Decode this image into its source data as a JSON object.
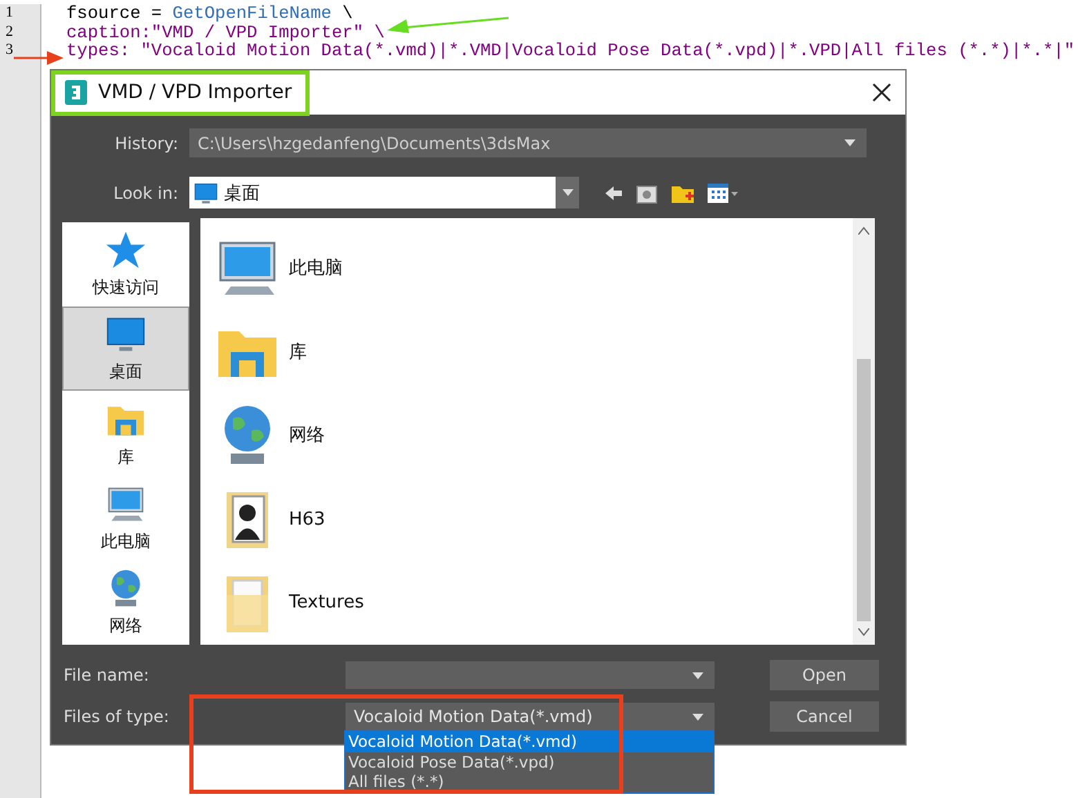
{
  "editor": {
    "lines": [
      {
        "number": "1",
        "segments": [
          {
            "kind": "plain",
            "text": "fsource = "
          },
          {
            "kind": "function",
            "text": "GetOpenFileName"
          },
          {
            "kind": "plain",
            "text": " \\"
          }
        ]
      },
      {
        "number": "2",
        "segments": [
          {
            "kind": "string",
            "text": "caption:\"VMD / VPD Importer\" \\"
          }
        ]
      },
      {
        "number": "3",
        "segments": [
          {
            "kind": "string",
            "text": "types: \"Vocaloid Motion Data(*.vmd)|*.VMD|Vocaloid Pose Data(*.vpd)|*.VPD|All files (*.*)|*.*|\""
          }
        ]
      }
    ]
  },
  "dialog": {
    "title": "VMD / VPD Importer",
    "history": {
      "label": "History:",
      "value": "C:\\Users\\hzgedanfeng\\Documents\\3dsMax"
    },
    "look_in": {
      "label": "Look in:",
      "value": "桌面"
    },
    "places": [
      {
        "label": "快速访问",
        "kind": "star",
        "selected": false
      },
      {
        "label": "桌面",
        "kind": "desktop",
        "selected": true
      },
      {
        "label": "库",
        "kind": "library",
        "selected": false
      },
      {
        "label": "此电脑",
        "kind": "computer",
        "selected": false
      },
      {
        "label": "网络",
        "kind": "network",
        "selected": false
      }
    ],
    "files": [
      {
        "name": "此电脑",
        "kind": "computer"
      },
      {
        "name": "库",
        "kind": "library"
      },
      {
        "name": "网络",
        "kind": "network"
      },
      {
        "name": "H63",
        "kind": "user"
      },
      {
        "name": "Textures",
        "kind": "folder"
      }
    ],
    "file_name": {
      "label": "File name:"
    },
    "files_of_type": {
      "label": "Files of type:",
      "value": "Vocaloid Motion Data(*.vmd)",
      "expanded": true,
      "options": [
        {
          "label": "Vocaloid Motion Data(*.vmd)",
          "selected": true
        },
        {
          "label": "Vocaloid Pose Data(*.vpd)",
          "selected": false
        },
        {
          "label": "All files (*.*)",
          "selected": false
        }
      ]
    },
    "buttons": [
      "Open",
      "Cancel"
    ]
  },
  "annotations": [
    {
      "kind": "arrow",
      "color": "#66dd22"
    },
    {
      "kind": "arrow",
      "color": "#e8401c"
    },
    {
      "kind": "box",
      "color": "#7ed321"
    },
    {
      "kind": "box",
      "color": "#e8401c"
    }
  ]
}
